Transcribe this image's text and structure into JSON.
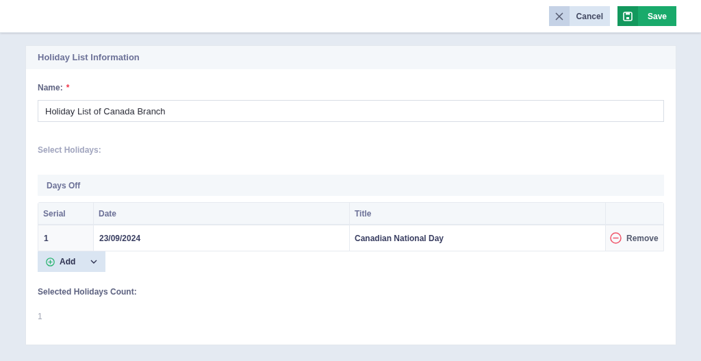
{
  "toolbar": {
    "cancel": "Cancel",
    "save": "Save"
  },
  "card": {
    "title": "Holiday List Information"
  },
  "name_field": {
    "label": "Name:",
    "required_mark": "*",
    "value": "Holiday List of Canada Branch"
  },
  "select_holidays_label": "Select Holidays:",
  "section_title": "Days Off",
  "table": {
    "columns": [
      "Serial",
      "Date",
      "Title"
    ],
    "rows": [
      {
        "serial": "1",
        "date": "23/09/2024",
        "title": "Canadian National Day",
        "action": "Remove"
      }
    ]
  },
  "add_button": "Add",
  "count": {
    "label": "Selected Holidays Count:",
    "value": "1"
  }
}
